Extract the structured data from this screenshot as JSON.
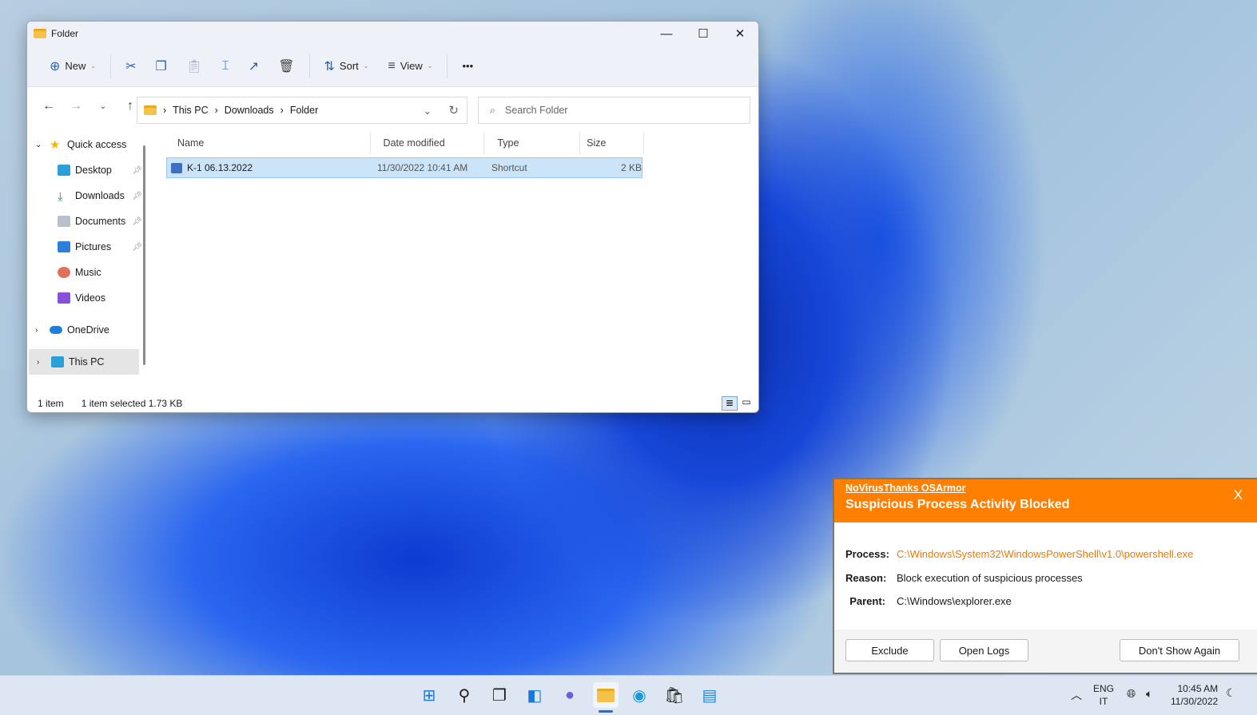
{
  "explorer": {
    "title": "Folder",
    "toolbar": {
      "new": "New",
      "sort": "Sort",
      "view": "View",
      "more": "•••"
    },
    "breadcrumb": [
      "This PC",
      "Downloads",
      "Folder"
    ],
    "search_placeholder": "Search Folder",
    "sidebar": [
      {
        "label": "Quick access"
      },
      {
        "label": "Desktop"
      },
      {
        "label": "Downloads"
      },
      {
        "label": "Documents"
      },
      {
        "label": "Pictures"
      },
      {
        "label": "Music"
      },
      {
        "label": "Videos"
      },
      {
        "label": "OneDrive"
      },
      {
        "label": "This PC"
      }
    ],
    "columns": [
      "Name",
      "Date modified",
      "Type",
      "Size"
    ],
    "files": [
      {
        "name": "K-1 06.13.2022",
        "date": "11/30/2022 10:41 AM",
        "type": "Shortcut",
        "size": "2 KB"
      }
    ],
    "status": {
      "count": "1 item",
      "selected": "1 item selected  1.73 KB"
    }
  },
  "popup": {
    "brand": "NoVirusThanks OSArmor",
    "title": "Suspicious Process Activity Blocked",
    "close": "X",
    "process_label": "Process:",
    "process": "C:\\Windows\\System32\\WindowsPowerShell\\v1.0\\powershell.exe",
    "reason_label": "Reason:",
    "reason": "Block execution of suspicious processes",
    "parent_label": "Parent:",
    "parent": "C:\\Windows\\explorer.exe",
    "buttons": {
      "exclude": "Exclude",
      "logs": "Open Logs",
      "dont": "Don't Show Again"
    }
  },
  "tray": {
    "lang1": "ENG",
    "lang2": "IT",
    "time": "10:45 AM",
    "date": "11/30/2022"
  },
  "colors": {
    "accent": "#ff8000"
  }
}
